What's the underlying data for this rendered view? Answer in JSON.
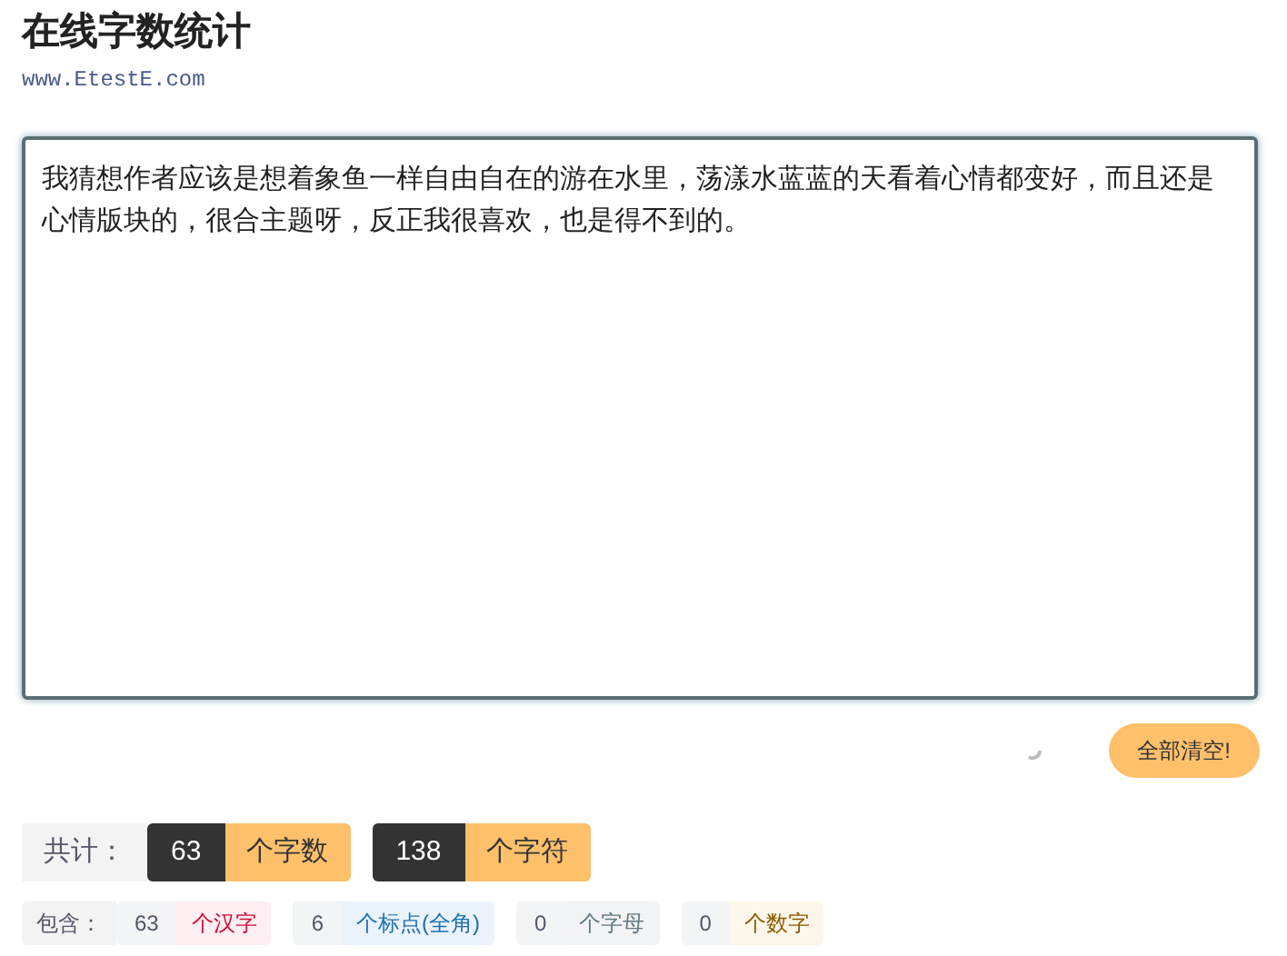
{
  "title": "在线字数统计",
  "site": "www.EtestE.com",
  "text": "我猜想作者应该是想着象鱼一样自由自在的游在水里，荡漾水蓝蓝的天看着心情都变好，而且还是心情版块的，很合主题呀，反正我很喜欢，也是得不到的。",
  "clear_button": "全部清空!",
  "totals": {
    "label": "共计：",
    "items": [
      {
        "count": "63",
        "unit": "个字数"
      },
      {
        "count": "138",
        "unit": "个字符"
      }
    ]
  },
  "breakdown": {
    "label": "包含：",
    "items": [
      {
        "kind": "hanzi",
        "count": "63",
        "unit": "个汉字"
      },
      {
        "kind": "punct",
        "count": "6",
        "unit": "个标点(全角)"
      },
      {
        "kind": "letter",
        "count": "0",
        "unit": "个字母"
      },
      {
        "kind": "digit",
        "count": "0",
        "unit": "个数字"
      }
    ]
  }
}
